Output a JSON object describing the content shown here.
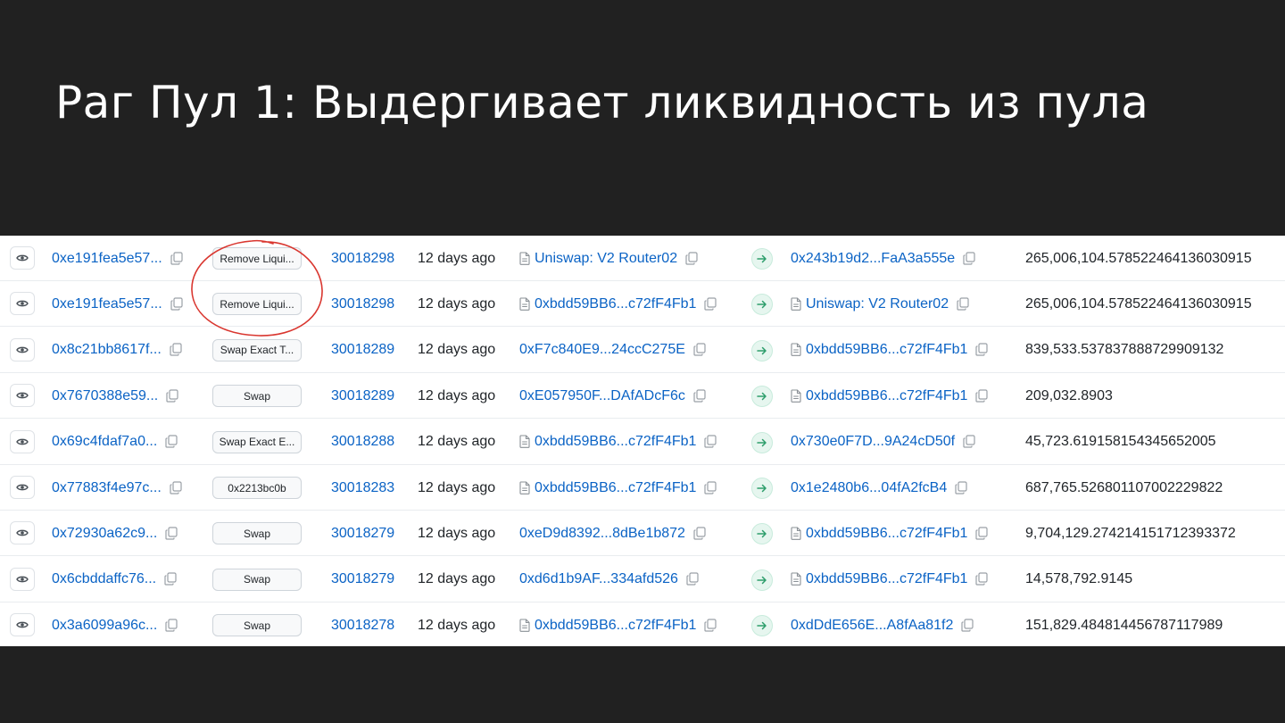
{
  "slide": {
    "title": "Раг Пул 1: Выдергивает ликвидность из пула"
  },
  "colors": {
    "background": "#212121",
    "link": "#0b63c5",
    "annotation": "#d9362f",
    "arrow": "#2e9e6c"
  },
  "transactions": [
    {
      "hash": "0xe191fea5e57...",
      "method": "Remove Liqui...",
      "block": "30018298",
      "age": "12 days ago",
      "from": "Uniswap: V2 Router02",
      "from_contract": true,
      "to": "0x243b19d2...FaA3a555e",
      "to_contract": false,
      "value": "265,006,104.578522464136030915"
    },
    {
      "hash": "0xe191fea5e57...",
      "method": "Remove Liqui...",
      "block": "30018298",
      "age": "12 days ago",
      "from": "0xbdd59BB6...c72fF4Fb1",
      "from_contract": true,
      "to": "Uniswap: V2 Router02",
      "to_contract": true,
      "value": "265,006,104.578522464136030915"
    },
    {
      "hash": "0x8c21bb8617f...",
      "method": "Swap Exact T...",
      "block": "30018289",
      "age": "12 days ago",
      "from": "0xF7c840E9...24ccC275E",
      "from_contract": false,
      "to": "0xbdd59BB6...c72fF4Fb1",
      "to_contract": true,
      "value": "839,533.537837888729909132"
    },
    {
      "hash": "0x7670388e59...",
      "method": "Swap",
      "block": "30018289",
      "age": "12 days ago",
      "from": "0xE057950F...DAfADcF6c",
      "from_contract": false,
      "to": "0xbdd59BB6...c72fF4Fb1",
      "to_contract": true,
      "value": "209,032.8903"
    },
    {
      "hash": "0x69c4fdaf7a0...",
      "method": "Swap Exact E...",
      "block": "30018288",
      "age": "12 days ago",
      "from": "0xbdd59BB6...c72fF4Fb1",
      "from_contract": true,
      "to": "0x730e0F7D...9A24cD50f",
      "to_contract": false,
      "value": "45,723.619158154345652005"
    },
    {
      "hash": "0x77883f4e97c...",
      "method": "0x2213bc0b",
      "block": "30018283",
      "age": "12 days ago",
      "from": "0xbdd59BB6...c72fF4Fb1",
      "from_contract": true,
      "to": "0x1e2480b6...04fA2fcB4",
      "to_contract": false,
      "value": "687,765.526801107002229822"
    },
    {
      "hash": "0x72930a62c9...",
      "method": "Swap",
      "block": "30018279",
      "age": "12 days ago",
      "from": "0xeD9d8392...8dBe1b872",
      "from_contract": false,
      "to": "0xbdd59BB6...c72fF4Fb1",
      "to_contract": true,
      "value": "9,704,129.274214151712393372"
    },
    {
      "hash": "0x6cbddaffc76...",
      "method": "Swap",
      "block": "30018279",
      "age": "12 days ago",
      "from": "0xd6d1b9AF...334afd526",
      "from_contract": false,
      "to": "0xbdd59BB6...c72fF4Fb1",
      "to_contract": true,
      "value": "14,578,792.9145"
    },
    {
      "hash": "0x3a6099a96c...",
      "method": "Swap",
      "block": "30018278",
      "age": "12 days ago",
      "from": "0xbdd59BB6...c72fF4Fb1",
      "from_contract": true,
      "to": "0xdDdE656E...A8fAa81f2",
      "to_contract": false,
      "value": "151,829.484814456787117989"
    }
  ]
}
